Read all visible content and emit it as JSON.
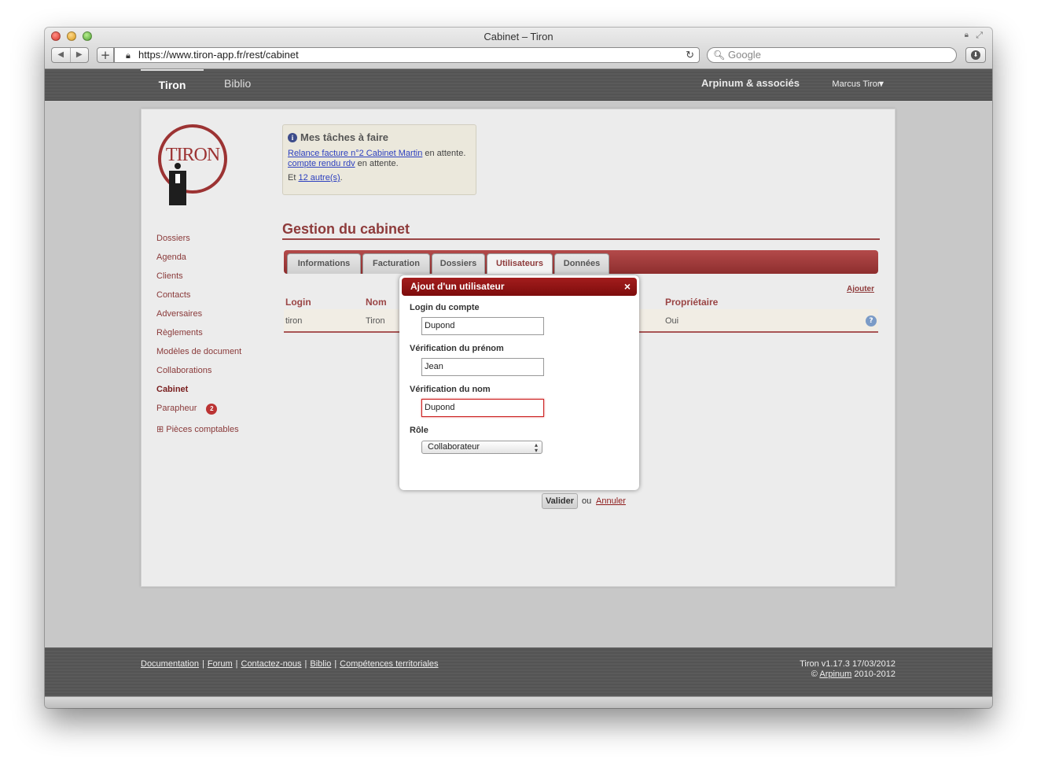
{
  "browser": {
    "window_title": "Cabinet – Tiron",
    "url": "https://www.tiron-app.fr/rest/cabinet",
    "search_placeholder": "Google"
  },
  "topnav": {
    "tabs": [
      "Tiron",
      "Biblio"
    ],
    "firm": "Arpinum & associés",
    "user": "Marcus Tiron"
  },
  "logo_text": "TIRON",
  "sidebar": {
    "items": [
      "Dossiers",
      "Agenda",
      "Clients",
      "Contacts",
      "Adversaires",
      "Règlements",
      "Modèles de document",
      "Collaborations",
      "Cabinet",
      "Parapheur"
    ],
    "active": "Cabinet",
    "parapheur_badge": "2",
    "extra": "⊞ Pièces comptables"
  },
  "tasks": {
    "title": "Mes tâches à faire",
    "line1_link": "Relance facture n°2 Cabinet Martin",
    "line1_rest": " en attente.",
    "line2_link": "compte rendu rdv",
    "line2_rest": " en attente.",
    "line3_prefix": "Et ",
    "line3_link": "12 autre(s)",
    "line3_suffix": "."
  },
  "section": {
    "title": "Gestion du cabinet",
    "tabs": [
      "Informations",
      "Facturation",
      "Dossiers",
      "Utilisateurs",
      "Données"
    ],
    "active_tab": "Utilisateurs"
  },
  "users": {
    "add_link": "Ajouter",
    "headers": [
      "Login",
      "Nom",
      "Propriétaire"
    ],
    "rows": [
      {
        "login": "tiron",
        "nom": "Tiron",
        "proprietaire": "Oui"
      }
    ]
  },
  "modal": {
    "title": "Ajout d'un utilisateur",
    "close": "×",
    "fields": [
      {
        "label": "Login du compte",
        "value": "Dupond"
      },
      {
        "label": "Vérification du prénom",
        "value": "Jean"
      },
      {
        "label": "Vérification du nom",
        "value": "Dupond"
      }
    ],
    "role_label": "Rôle",
    "role_value": "Collaborateur",
    "submit": "Valider",
    "or": "ou",
    "cancel": "Annuler"
  },
  "footer": {
    "links": [
      "Documentation",
      "Forum",
      "Contactez-nous",
      "Biblio",
      "Compétences territoriales"
    ],
    "version": "Tiron v1.17.3 17/03/2012",
    "copyright_prefix": "© ",
    "copyright_link": "Arpinum",
    "copyright_suffix": " 2010-2012"
  },
  "colors": {
    "accent": "#8e3b3b",
    "modal_header": "#8d1414",
    "nav_bg": "#575757"
  }
}
